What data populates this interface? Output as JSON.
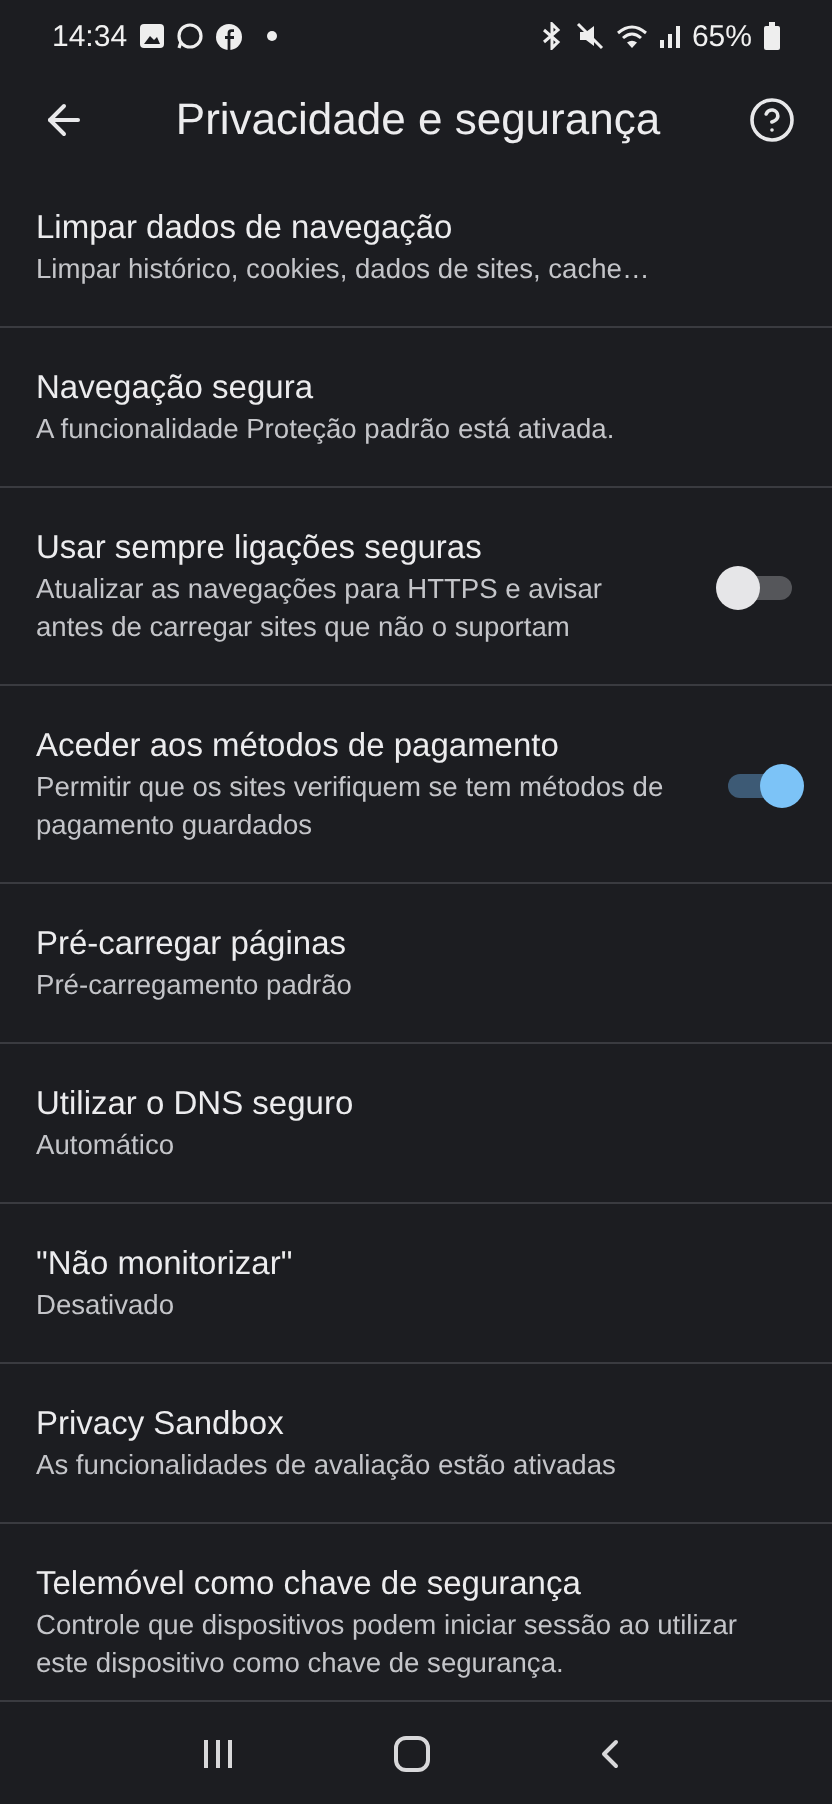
{
  "status_bar": {
    "time": "14:34",
    "battery_text": "65%"
  },
  "header": {
    "title": "Privacidade e segurança"
  },
  "settings": [
    {
      "kind": "link",
      "title": "Limpar dados de navegação",
      "subtitle": "Limpar histórico, cookies, dados de sites, cache…"
    },
    {
      "kind": "link",
      "title": "Navegação segura",
      "subtitle": "A funcionalidade Proteção padrão está ativada."
    },
    {
      "kind": "toggle",
      "title": "Usar sempre ligações seguras",
      "subtitle": "Atualizar as navegações para HTTPS e avisar antes de carregar sites que não o suportam",
      "on": false
    },
    {
      "kind": "toggle",
      "title": "Aceder aos métodos de pagamento",
      "subtitle": "Permitir que os sites verifiquem se tem métodos de pagamento guardados",
      "on": true
    },
    {
      "kind": "link",
      "title": "Pré-carregar páginas",
      "subtitle": "Pré-carregamento padrão"
    },
    {
      "kind": "link",
      "title": "Utilizar o DNS seguro",
      "subtitle": "Automático"
    },
    {
      "kind": "link",
      "title": "\"Não monitorizar\"",
      "subtitle": "Desativado"
    },
    {
      "kind": "link",
      "title": "Privacy Sandbox",
      "subtitle": "As funcionalidades de avaliação estão ativadas"
    },
    {
      "kind": "link",
      "title": "Telemóvel como chave de segurança",
      "subtitle": "Controle que dispositivos podem iniciar sessão ao utilizar este dispositivo como chave de segurança."
    }
  ]
}
